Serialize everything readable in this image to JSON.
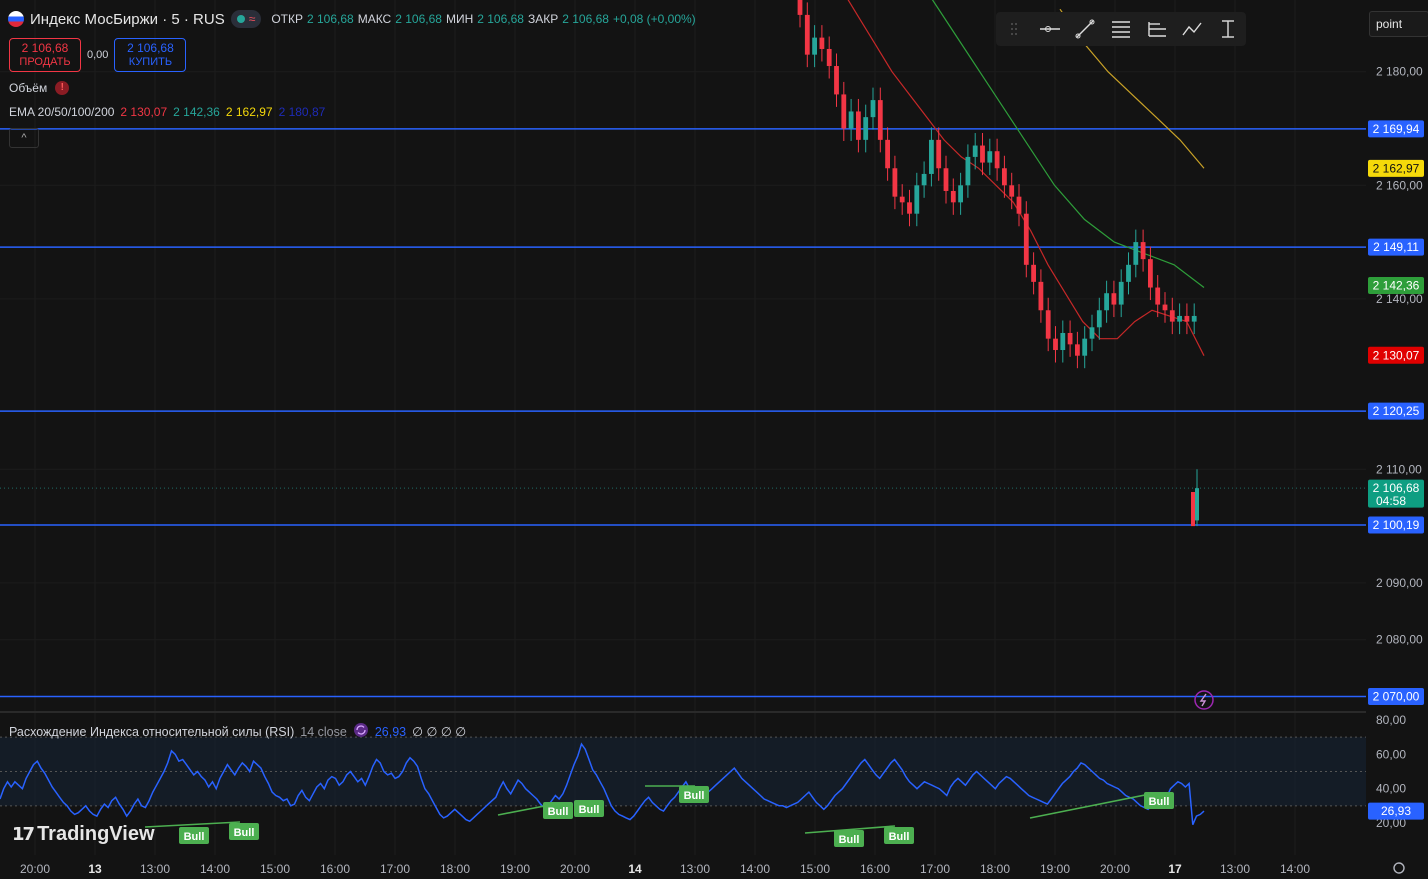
{
  "header": {
    "symbol": "Индекс МосБиржи · 5 · RUS",
    "ohlc": [
      {
        "k": "ОТКР",
        "v": "2 106,68"
      },
      {
        "k": "МАКС",
        "v": "2 106,68"
      },
      {
        "k": "МИН",
        "v": "2 106,68"
      },
      {
        "k": "ЗАКР",
        "v": "2 106,68"
      }
    ],
    "change": "+0,08 (+0,00%)"
  },
  "trade": {
    "sell_price": "2 106,68",
    "sell_label": "ПРОДАТЬ",
    "spread": "0,00",
    "buy_price": "2 106,68",
    "buy_label": "КУПИТЬ"
  },
  "volume_label": "Объём",
  "ema": {
    "label": "EMA 20/50/100/200",
    "v20": "2 130,07",
    "v50": "2 142,36",
    "v100": "2 162,97",
    "v200": "2 180,87"
  },
  "toolbar_tools": [
    "horizontal-ray-icon",
    "trend-line-icon",
    "fib-icon",
    "long-short-icon",
    "path-icon",
    "measure-icon"
  ],
  "point_label": "point",
  "colors": {
    "bg": "#131313",
    "hline": "#2962ff",
    "up": "#26a69a",
    "down": "#f23645",
    "ema20": "#c62828",
    "ema50": "#2e9e3a",
    "ema100": "#c9a227",
    "rsi": "#2962ff"
  },
  "chart_data": {
    "type": "candlestick",
    "price_axis_ticks": [
      "2 180,00",
      "2 160,00",
      "2 140,00",
      "2 110,00",
      "2 090,00",
      "2 080,00"
    ],
    "horizontal_levels": [
      "2 169,94",
      "2 149,11",
      "2 120,25",
      "2 100,19",
      "2 070,00"
    ],
    "price_tags": [
      {
        "value": "2 169,94",
        "kind": "level"
      },
      {
        "value": "2 162,97",
        "kind": "ema100"
      },
      {
        "value": "2 149,11",
        "kind": "level"
      },
      {
        "value": "2 142,36",
        "kind": "ema50"
      },
      {
        "value": "2 130,07",
        "kind": "ema20"
      },
      {
        "value": "2 120,25",
        "kind": "level"
      },
      {
        "value": "2 106,68",
        "kind": "last",
        "sub": "04:58"
      },
      {
        "value": "2 100,19",
        "kind": "level"
      },
      {
        "value": "2 070,00",
        "kind": "level"
      }
    ],
    "closes": [
      2190,
      2183,
      2186,
      2184,
      2181,
      2176,
      2170,
      2173,
      2168,
      2172,
      2175,
      2168,
      2163,
      2158,
      2157,
      2155,
      2160,
      2162,
      2168,
      2163,
      2159,
      2157,
      2160,
      2165,
      2167,
      2164,
      2166,
      2163,
      2160,
      2158,
      2155,
      2146,
      2143,
      2138,
      2133,
      2131,
      2134,
      2132,
      2130,
      2133,
      2135,
      2138,
      2141,
      2139,
      2143,
      2146,
      2150,
      2147,
      2142,
      2139,
      2138,
      2136,
      2137,
      2136,
      2137
    ],
    "last_bar": {
      "open": 2101,
      "close": 2106.68,
      "low": 2100,
      "high": 2110
    },
    "ema20": [
      2195,
      2190,
      2185,
      2180,
      2176,
      2172,
      2168,
      2165,
      2163,
      2160,
      2157,
      2152,
      2146,
      2141,
      2136,
      2133,
      2133,
      2136,
      2138,
      2137,
      2136,
      2130
    ],
    "ema50": [
      2200,
      2192,
      2184,
      2176,
      2168,
      2160,
      2154,
      2150,
      2148,
      2146,
      2142
    ],
    "ema100": [
      2191,
      2185,
      2180,
      2176,
      2172,
      2168,
      2163
    ],
    "time_labels": [
      "20:00",
      "13",
      "13:00",
      "14:00",
      "15:00",
      "16:00",
      "17:00",
      "18:00",
      "19:00",
      "20:00",
      "14",
      "13:00",
      "14:00",
      "15:00",
      "16:00",
      "17:00",
      "18:00",
      "19:00",
      "20:00",
      "17",
      "13:00",
      "14:00"
    ]
  },
  "rsi": {
    "title": "Расхождение Индекса относительной силы (RSI)",
    "params": "14 close",
    "value": "26,93",
    "extra": "∅ ∅ ∅ ∅",
    "axis_ticks": [
      "80,00",
      "60,00",
      "40,00",
      "20,00"
    ],
    "tag": "26,93",
    "values": [
      34,
      40,
      44,
      41,
      44,
      42,
      40,
      46,
      50,
      54,
      56,
      52,
      49,
      45,
      41,
      38,
      35,
      32,
      30,
      27,
      25,
      26,
      28,
      30,
      27,
      25,
      24,
      28,
      31,
      29,
      33,
      35,
      31,
      28,
      24,
      27,
      31,
      34,
      30,
      29,
      33,
      38,
      42,
      46,
      50,
      55,
      62,
      60,
      56,
      57,
      54,
      51,
      48,
      50,
      47,
      45,
      41,
      44,
      40,
      46,
      50,
      54,
      51,
      48,
      52,
      55,
      53,
      50,
      56,
      54,
      52,
      47,
      43,
      38,
      36,
      35,
      33,
      34,
      30,
      31,
      36,
      39,
      35,
      33,
      37,
      41,
      43,
      40,
      45,
      47,
      46,
      42,
      44,
      48,
      50,
      47,
      44,
      46,
      42,
      47,
      53,
      57,
      55,
      50,
      48,
      49,
      46,
      47,
      50,
      55,
      58,
      56,
      53,
      46,
      40,
      37,
      33,
      29,
      25,
      23,
      24,
      26,
      28,
      26,
      24,
      22,
      21,
      23,
      25,
      27,
      29,
      31,
      33,
      35,
      40,
      44,
      40,
      37,
      41,
      45,
      43,
      40,
      38,
      36,
      34,
      31,
      29,
      30,
      33,
      36,
      34,
      37,
      42,
      48,
      54,
      59,
      66,
      63,
      57,
      51,
      48,
      44,
      40,
      35,
      30,
      27,
      25,
      24,
      23,
      22,
      24,
      27,
      30,
      33,
      35,
      32,
      30,
      28,
      27,
      30,
      33,
      35,
      38,
      41,
      44,
      40,
      38,
      36,
      34,
      36,
      38,
      40,
      42,
      44,
      46,
      48,
      50,
      52,
      49,
      46,
      44,
      42,
      40,
      38,
      36,
      34,
      33,
      32,
      31,
      30,
      30,
      29,
      30,
      31,
      32,
      34,
      36,
      38,
      35,
      32,
      30,
      28,
      30,
      33,
      36,
      38,
      40,
      43,
      46,
      49,
      52,
      55,
      57,
      54,
      51,
      48,
      46,
      49,
      52,
      55,
      57,
      54,
      51,
      47,
      44,
      42,
      40,
      42,
      44,
      43,
      42,
      41,
      40,
      38,
      36,
      41,
      44,
      46,
      44,
      42,
      45,
      48,
      50,
      48,
      46,
      44,
      42,
      40,
      43,
      45,
      47,
      46,
      44,
      42,
      40,
      38,
      36,
      35,
      34,
      33,
      32,
      31,
      34,
      37,
      40,
      43,
      45,
      47,
      50,
      52,
      55,
      54,
      52,
      50,
      48,
      46,
      45,
      43,
      42,
      41,
      40,
      38,
      36,
      35,
      34,
      32,
      30,
      29,
      28,
      30,
      32,
      34,
      31,
      35,
      40,
      42,
      44,
      43,
      41,
      43,
      19,
      24,
      25,
      26.93
    ],
    "bull_labels": [
      "Bull",
      "Bull",
      "Bull",
      "Bull",
      "Bull",
      "Bull",
      "Bull",
      "Bull"
    ]
  },
  "branding": "TradingView"
}
